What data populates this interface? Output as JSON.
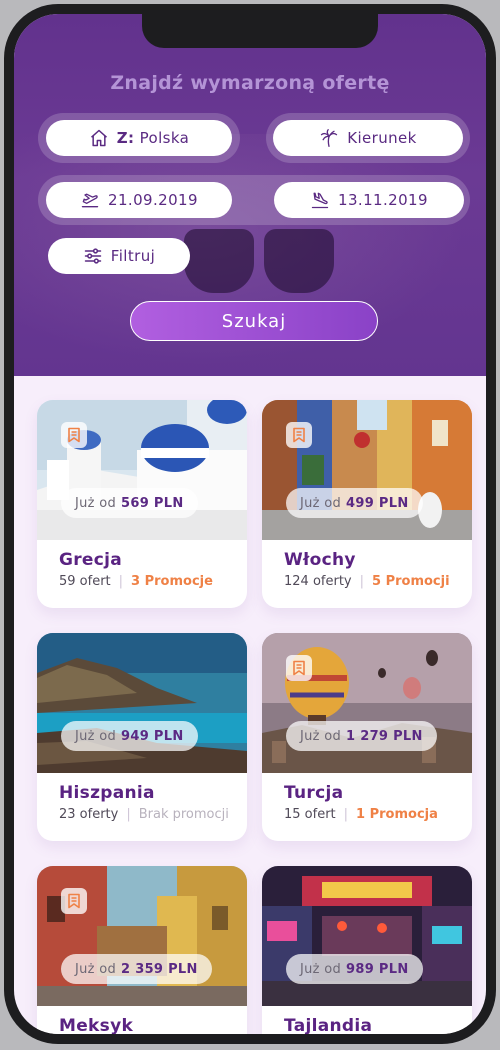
{
  "header": {
    "title": "Znajdź wymarzoną ofertę",
    "from_prefix": "Z:",
    "from_value": "Polska",
    "destination": "Kierunek",
    "date_from": "21.09.2019",
    "date_to": "13.11.2019",
    "filter": "Filtruj",
    "search": "Szukaj"
  },
  "colors": {
    "accent": "#5a2382",
    "promo": "#ef8146",
    "header": "#62328d"
  },
  "offers": [
    {
      "name": "Grecja",
      "price_prefix": "Już od",
      "price": "569 PLN",
      "count": "59 ofert",
      "promo": "3 Promocje",
      "has_promo": true,
      "icon": "bookmark-icon"
    },
    {
      "name": "Włochy",
      "price_prefix": "Już od",
      "price": "499 PLN",
      "count": "124 oferty",
      "promo": "5 Promocji",
      "has_promo": true,
      "icon": "bookmark-icon"
    },
    {
      "name": "Hiszpania",
      "price_prefix": "Już od",
      "price": "949 PLN",
      "count": "23 oferty",
      "promo": "Brak promocji",
      "has_promo": false
    },
    {
      "name": "Turcja",
      "price_prefix": "Już od",
      "price": "1 279 PLN",
      "count": "15 ofert",
      "promo": "1 Promocja",
      "has_promo": true,
      "icon": "bookmark-icon"
    },
    {
      "name": "Meksyk",
      "price_prefix": "Już od",
      "price": "2 359 PLN",
      "icon": "bookmark-icon"
    },
    {
      "name": "Tajlandia",
      "price_prefix": "Już od",
      "price": "989 PLN"
    }
  ]
}
